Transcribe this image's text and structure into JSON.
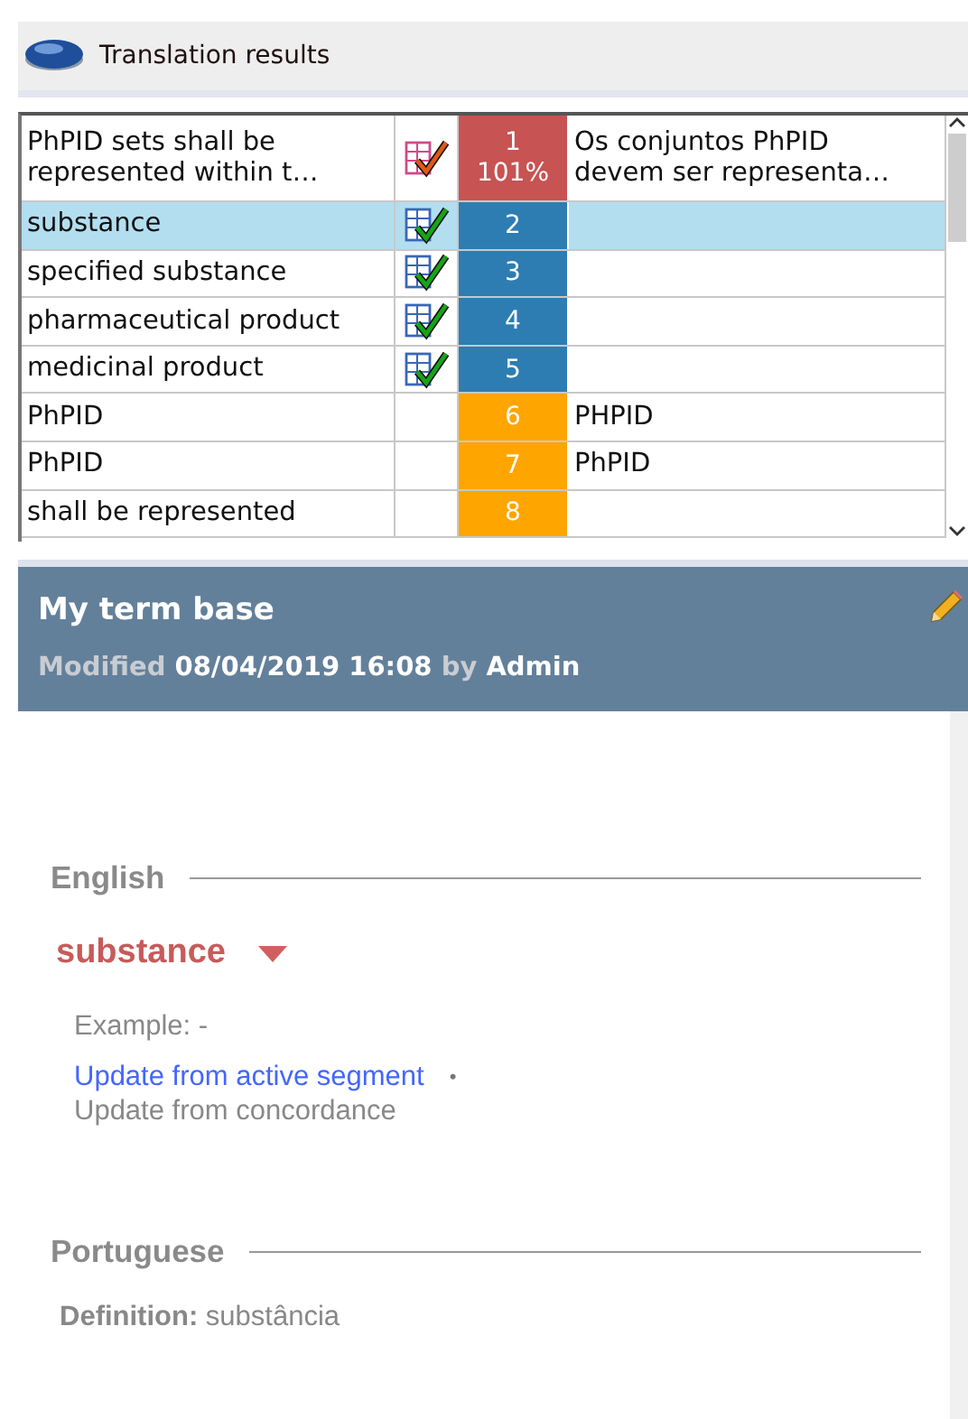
{
  "panel": {
    "title": "Translation results"
  },
  "results": [
    {
      "source": "PhPID sets shall be represented within t…",
      "kind": "tm",
      "number": "1",
      "percent": "101%",
      "target": "Os conjuntos PhPID devem ser representa…",
      "selected": false
    },
    {
      "source": "substance",
      "kind": "termbase",
      "number": "2",
      "selected": true
    },
    {
      "source": "specified substance",
      "kind": "termbase",
      "number": "3",
      "selected": false
    },
    {
      "source": "pharmaceutical product",
      "kind": "termbase",
      "number": "4",
      "selected": false
    },
    {
      "source": "medicinal product",
      "kind": "termbase",
      "number": "5",
      "selected": false
    },
    {
      "source": "PhPID",
      "kind": "nontranslatable",
      "number": "6",
      "target": "PHPID",
      "selected": false
    },
    {
      "source": "PhPID",
      "kind": "nontranslatable",
      "number": "7",
      "target": "PhPID",
      "selected": false
    },
    {
      "source": "shall be represented",
      "kind": "nontranslatable",
      "number": "8",
      "selected": false
    }
  ],
  "termbase": {
    "title": "My term base",
    "modified": "Modified **08/04/2019 16:08** by **Admin**"
  },
  "sections": [
    {
      "language": "English",
      "term": "substance",
      "example": "Example: -",
      "links": [
        {
          "label": "Update from active segment",
          "active": true
        },
        {
          "label": "Update from concordance",
          "active": false
        }
      ],
      "separator": "•"
    },
    {
      "language": "Portuguese",
      "definition": "**Definition:** substância"
    }
  ]
}
